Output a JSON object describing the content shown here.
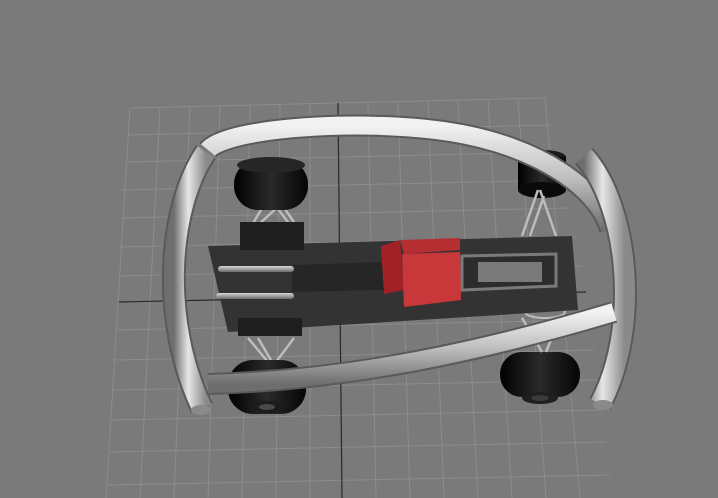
{
  "viewport": {
    "background": "#7a7a7a",
    "grid_color": "#8c8c8c",
    "axis_color": "#2a2a2a"
  },
  "model": {
    "icons": [
      "tube-frame-icon",
      "tire-icon",
      "chassis-plate-icon",
      "engine-block-icon",
      "suspension-arm-icon",
      "axle-rod-icon"
    ],
    "colors": {
      "tube": "#bdbdbd",
      "tire": "#141414",
      "chassis": "#333333",
      "engine": "#c8373a"
    }
  }
}
